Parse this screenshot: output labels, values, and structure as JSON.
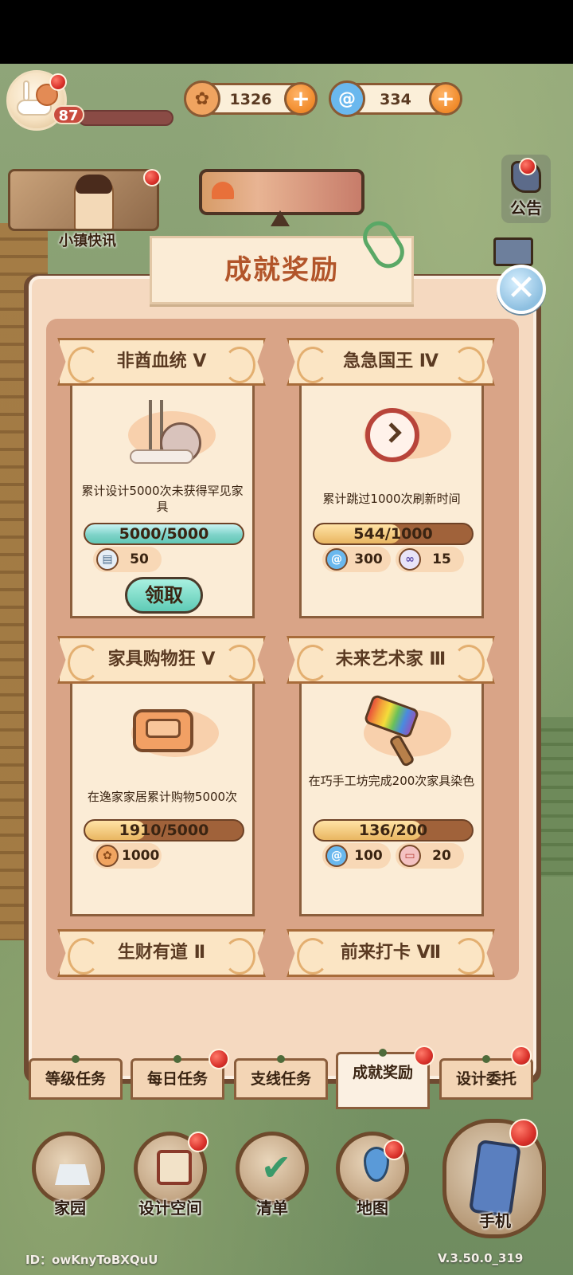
{
  "player": {
    "level": "87",
    "avatar_icon": "snail-avatar-icon"
  },
  "currency": [
    {
      "icon": "coin-icon",
      "value": "1326",
      "color": "#f0a460"
    },
    {
      "icon": "swirl-icon",
      "value": "334",
      "color": "#4aa3e0"
    }
  ],
  "news": {
    "label": "小镇快讯"
  },
  "side": {
    "announce_label": "公告"
  },
  "panel": {
    "title": "成就奖励",
    "close_glyph": "✕"
  },
  "achievements": [
    {
      "title": "非酋血统 Ⅴ",
      "desc": "累计设计5000次未获得罕见家具",
      "progress_text": "5000/5000",
      "progress": 1.0,
      "rewards": [
        {
          "icon": "scroll-icon",
          "value": "50"
        }
      ],
      "claim_label": "领取"
    },
    {
      "title": "急急国王 Ⅳ",
      "desc": "累计跳过1000次刷新时间",
      "progress_text": "544/1000",
      "progress": 0.544,
      "rewards": [
        {
          "icon": "swirl-icon",
          "value": "300"
        },
        {
          "icon": "ticket-icon",
          "value": "15"
        }
      ]
    },
    {
      "title": "家具购物狂 Ⅴ",
      "desc": "在逸家家居累计购物5000次",
      "progress_text": "1910/5000",
      "progress": 0.382,
      "rewards": [
        {
          "icon": "coin-icon",
          "value": "1000"
        }
      ]
    },
    {
      "title": "未来艺术家 Ⅲ",
      "desc": "在巧手工坊完成200次家具染色",
      "progress_text": "136/200",
      "progress": 0.68,
      "rewards": [
        {
          "icon": "swirl-icon",
          "value": "100"
        },
        {
          "icon": "coupon-icon",
          "value": "20"
        }
      ]
    },
    {
      "title": "生财有道 Ⅱ"
    },
    {
      "title": "前来打卡 Ⅶ"
    }
  ],
  "tabs": [
    {
      "label": "等级任务",
      "active": false,
      "badge": false
    },
    {
      "label": "每日任务",
      "active": false,
      "badge": true
    },
    {
      "label": "支线任务",
      "active": false,
      "badge": false
    },
    {
      "label": "成就奖励",
      "active": true,
      "badge": true
    },
    {
      "label": "设计委托",
      "active": false,
      "badge": true
    }
  ],
  "nav": [
    {
      "label": "家园",
      "icon": "home-icon"
    },
    {
      "label": "设计空间",
      "icon": "design-icon"
    },
    {
      "label": "清单",
      "icon": "checklist-icon"
    },
    {
      "label": "地图",
      "icon": "map-pin-icon"
    },
    {
      "label": "手机",
      "icon": "phone-icon"
    }
  ],
  "footer": {
    "id_text": "ID：owKnyToBXQuU",
    "version": "V.3.50.0_319"
  }
}
